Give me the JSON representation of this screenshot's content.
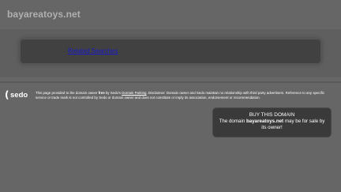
{
  "site": {
    "title": "bayareatoys.net"
  },
  "related": {
    "link_label": "Related Searches"
  },
  "sedo": {
    "logo_text": "sedo"
  },
  "disclaimer": {
    "part1": "This page provided to the domain owner ",
    "free": "free",
    "part2": " by Sedo's ",
    "parking_link": "Domain Parking",
    "part3": ". Disclaimer: Domain owner and Sedo maintain no relationship with third party advertisers. Reference to any specific service or trade mark is not controlled by Sedo or domain owner and does not constitute or imply its association, endorsement or recommendation."
  },
  "buy": {
    "title": "BUY THIS DOMAIN",
    "text_before": "The domain ",
    "domain": "bayareatoys.net",
    "text_after": " may be for sale by its owner!"
  }
}
